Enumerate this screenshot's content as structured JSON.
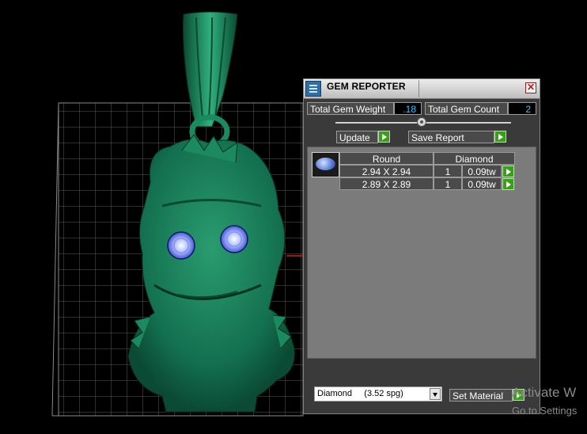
{
  "window": {
    "title": "GEM REPORTER",
    "close_glyph": "✕"
  },
  "totals": {
    "weight_label": "Total Gem Weight",
    "weight_value": ".18",
    "count_label": "Total Gem Count",
    "count_value": "2"
  },
  "buttons": {
    "update": "Update",
    "save_report": "Save Report",
    "set_material": "Set Material"
  },
  "gem_table": {
    "headers": {
      "shape": "Round",
      "material": "Diamond"
    },
    "rows": [
      {
        "size": "2.94 X 2.94",
        "qty": "1",
        "weight": "0.09tw"
      },
      {
        "size": "2.89 X 2.89",
        "qty": "1",
        "weight": "0.09tw"
      }
    ]
  },
  "material_select": {
    "selected": "Diamond     (3.52 spg)"
  },
  "watermark": {
    "line1": "Activate W",
    "line2": "Go to Settings"
  },
  "colors": {
    "model_green": "#1a8a62",
    "accent_blue": "#39c3ff",
    "go_green": "#3a9e1a"
  }
}
